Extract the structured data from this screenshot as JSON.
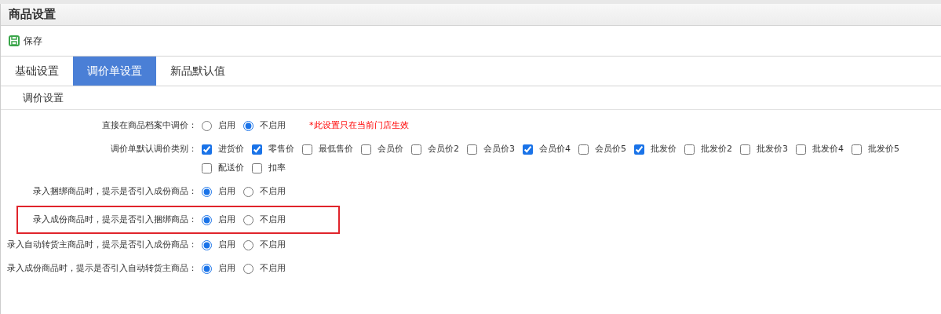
{
  "window": {
    "title": "商品设置"
  },
  "toolbar": [
    {
      "label": "保存"
    }
  ],
  "tabs": [
    {
      "label": "基础设置",
      "selected": false
    },
    {
      "label": "调价单设置",
      "selected": true
    },
    {
      "label": "新品默认值",
      "selected": false
    }
  ],
  "section": {
    "title": "调价设置"
  },
  "rows": [
    {
      "label": "直接在商品档案中调价：",
      "kind": "radio",
      "highlighted": false,
      "note": "*此设置只在当前门店生效",
      "options": [
        {
          "label": "启用",
          "selected": false
        },
        {
          "label": "不启用",
          "selected": true
        }
      ]
    },
    {
      "label": "调价单默认调价类别：",
      "kind": "checkbox",
      "highlighted": false,
      "options": [
        {
          "label": "进货价",
          "checked": true
        },
        {
          "label": "零售价",
          "checked": true
        },
        {
          "label": "最低售价",
          "checked": false
        },
        {
          "label": "会员价",
          "checked": false
        },
        {
          "label": "会员价2",
          "checked": false
        },
        {
          "label": "会员价3",
          "checked": false
        },
        {
          "label": "会员价4",
          "checked": true
        },
        {
          "label": "会员价5",
          "checked": false
        },
        {
          "label": "批发价",
          "checked": true
        },
        {
          "label": "批发价2",
          "checked": false
        },
        {
          "label": "批发价3",
          "checked": false
        },
        {
          "label": "批发价4",
          "checked": false
        },
        {
          "label": "批发价5",
          "checked": false
        },
        {
          "label": "配送价",
          "checked": false
        },
        {
          "label": "扣率",
          "checked": false
        }
      ]
    },
    {
      "label": "录入捆绑商品时，提示是否引入成份商品：",
      "kind": "radio",
      "highlighted": false,
      "options": [
        {
          "label": "启用",
          "selected": true
        },
        {
          "label": "不启用",
          "selected": false
        }
      ]
    },
    {
      "label": "录入成份商品时，提示是否引入捆绑商品：",
      "kind": "radio",
      "highlighted": true,
      "options": [
        {
          "label": "启用",
          "selected": true
        },
        {
          "label": "不启用",
          "selected": false
        }
      ]
    },
    {
      "label": "录入自动转货主商品时，提示是否引入成份商品：",
      "kind": "radio",
      "highlighted": false,
      "options": [
        {
          "label": "启用",
          "selected": true
        },
        {
          "label": "不启用",
          "selected": false
        }
      ]
    },
    {
      "label": "录入成份商品时，提示是否引入自动转货主商品：",
      "kind": "radio",
      "highlighted": false,
      "options": [
        {
          "label": "启用",
          "selected": true
        },
        {
          "label": "不启用",
          "selected": false
        }
      ]
    }
  ]
}
